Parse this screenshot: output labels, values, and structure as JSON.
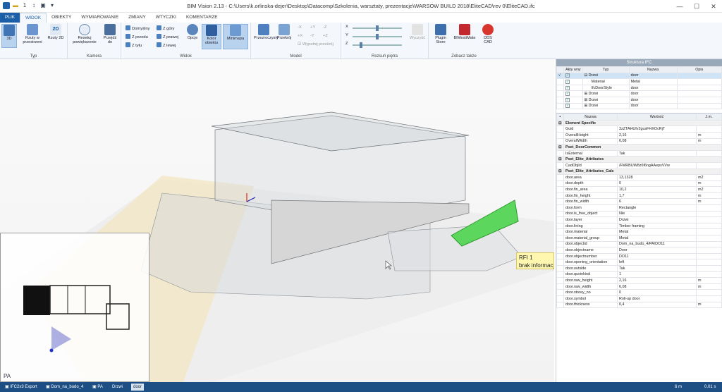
{
  "window": {
    "title": "BIM Vision 2.13 - C:\\Users\\k.orlinska-dejer\\Desktop\\Datacomp\\Szkolenia, warsztaty, prezentacje\\WARSOW BUILD 2018\\EliteCAD\\rev 0\\EliteCAD.ifc",
    "qat_counter": "1"
  },
  "tabs": [
    "PLIK",
    "WIDOK",
    "OBIEKTY",
    "WYMIAROWANIE",
    "ZMIANY",
    "WTYCZKI",
    "KOMENTARZE"
  ],
  "ribbon": {
    "typ": {
      "label": "Typ",
      "b3d": "3D",
      "rzuty": "Rzuty w przestrzeni",
      "rzuty2d": "Rzuty 2D"
    },
    "kamera": {
      "label": "Kamera",
      "resetuj": "Resetuj powiększenie",
      "przejdz": "Przejdź do"
    },
    "widok": {
      "label": "Widok",
      "domyslny": "Domyślny",
      "z_gory": "Z góry",
      "z_przodu": "Z przodu",
      "z_prawej": "Z prawej",
      "z_tylu": "Z tyłu",
      "z_lewej": "Z lewej",
      "opcje": "Opcje",
      "kolor": "Kolor obiektu",
      "minimapa": "Minimapa"
    },
    "model": {
      "label": "Model",
      "przezroczysty": "Przezroczysty",
      "przekroj": "Przekrój",
      "axes": [
        "-X",
        "+Y",
        "-Z",
        "+X",
        "-Y",
        "+Z"
      ],
      "wypelnij": "Wypełnij przekrój"
    },
    "rozsun": {
      "label": "Rozsuń piętra",
      "x": "X",
      "y": "Y",
      "z": "Z",
      "wyczysc": "Wyczyść",
      "x_level": 0.5,
      "y_level": 0.5,
      "z_level": 0.15
    },
    "zobacz": {
      "label": "Zobacz także",
      "plugin": "Plugin Store",
      "bimest": "BIMestiMate",
      "dds": "DDS CAD"
    }
  },
  "viewport": {
    "rfi_title": "RFI 1",
    "rfi_text": "brak informacji",
    "minimap_label": "PA"
  },
  "structure": {
    "title": "Struktura IFC",
    "headers": [
      "Akty wny",
      "Typ",
      "Nazwa",
      "Opis"
    ],
    "rows": [
      {
        "sel": "√",
        "typ": "Drzwi",
        "nazwa": "door",
        "selected": true
      },
      {
        "sel": "",
        "typ": "Material",
        "nazwa": "Metal",
        "indent": true
      },
      {
        "sel": "",
        "typ": "IfcDoorStyle",
        "nazwa": "door",
        "indent": true
      },
      {
        "sel": "",
        "typ": "Drzwi",
        "nazwa": "door"
      },
      {
        "sel": "",
        "typ": "Drzwi",
        "nazwa": "door"
      },
      {
        "sel": "",
        "typ": "Drzwi",
        "nazwa": "door"
      }
    ]
  },
  "properties": {
    "headers": [
      "Nazwa",
      "Wartość",
      "J.m."
    ],
    "rows": [
      {
        "cat": "Element Specific"
      },
      {
        "n": "Guid",
        "v": "3zZTAHUfv2gusFHXOcRjT",
        "u": ""
      },
      {
        "n": "OverallHeight",
        "v": "2,16",
        "u": "m"
      },
      {
        "n": "OverallWidth",
        "v": "6,08",
        "u": "m"
      },
      {
        "cat": "Pset_DoorCommon"
      },
      {
        "n": "IsExternal",
        "v": "Tak",
        "u": ""
      },
      {
        "cat": "Pset_Elite_Attributes"
      },
      {
        "n": "CadObjId",
        "v": "/FMRBUW8z6f6ngAAepsVVw",
        "u": ""
      },
      {
        "cat": "Pset_Elite_Attributes_Calc"
      },
      {
        "n": "door.area",
        "v": "13,1328",
        "u": "m2"
      },
      {
        "n": "door.depth",
        "v": "0",
        "u": "m"
      },
      {
        "n": "door.fin_area",
        "v": "10,2",
        "u": "m2"
      },
      {
        "n": "door.fin_height",
        "v": "1,7",
        "u": "m"
      },
      {
        "n": "door.fin_width",
        "v": "6",
        "u": "m"
      },
      {
        "n": "door.form",
        "v": "Rectangle",
        "u": ""
      },
      {
        "n": "door.is_free_object",
        "v": "Nie",
        "u": ""
      },
      {
        "n": "door.layer",
        "v": "Drzwi",
        "u": ""
      },
      {
        "n": "door.lining",
        "v": "Timber framing",
        "u": ""
      },
      {
        "n": "door.material",
        "v": "Metal",
        "u": ""
      },
      {
        "n": "door.material_group",
        "v": "Metal",
        "u": ""
      },
      {
        "n": "door.objectid",
        "v": "Dom_na_budo_4/PA/DO11",
        "u": ""
      },
      {
        "n": "door.objectname",
        "v": "Door",
        "u": ""
      },
      {
        "n": "door.objectnumber",
        "v": "DO11",
        "u": ""
      },
      {
        "n": "door.opening_orientation",
        "v": "left",
        "u": ""
      },
      {
        "n": "door.outside",
        "v": "Tak",
        "u": ""
      },
      {
        "n": "door.quoinkind",
        "v": "1",
        "u": ""
      },
      {
        "n": "door.raw_height",
        "v": "2,16",
        "u": "m"
      },
      {
        "n": "door.raw_width",
        "v": "6,08",
        "u": "m"
      },
      {
        "n": "door.storey_no",
        "v": "0",
        "u": ""
      },
      {
        "n": "door.symbol",
        "v": "Roll-up door",
        "u": ""
      },
      {
        "n": "door.thickness",
        "v": "0,4",
        "u": "m"
      }
    ]
  },
  "status": {
    "crumbs": [
      "IFC2x3 Export",
      "Dom_na_budo_4",
      "PA",
      "Drzwi",
      "door"
    ],
    "right1": "6 m",
    "right2": "0.01 s"
  }
}
